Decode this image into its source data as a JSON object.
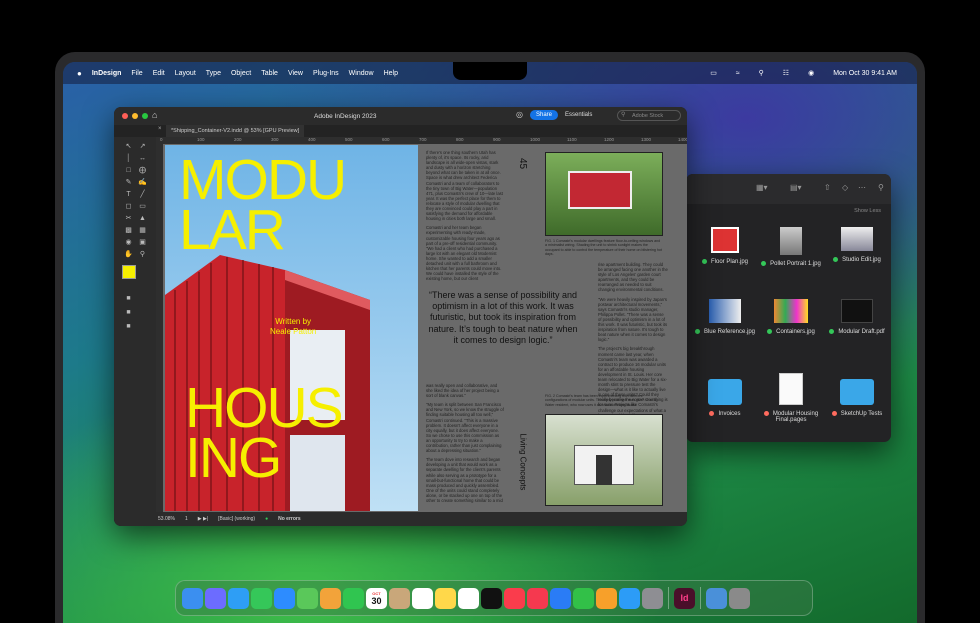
{
  "menubar": {
    "apple": "",
    "items": [
      "InDesign",
      "File",
      "Edit",
      "Layout",
      "Type",
      "Object",
      "Table",
      "View",
      "Plug-Ins",
      "Window",
      "Help"
    ],
    "datetime": "Mon Oct 30  9:41 AM"
  },
  "indesign": {
    "window_title": "Adobe InDesign 2023",
    "share_label": "Share",
    "workspace": "Essentials",
    "stock_placeholder": "Adobe Stock",
    "doc_tab": "*Shipping_Container-V2.indd @ 53% [GPU Preview]",
    "ruler_ticks": [
      "0",
      "100",
      "200",
      "300",
      "400",
      "500",
      "600",
      "700",
      "800",
      "900",
      "1000",
      "1100",
      "1200",
      "1300",
      "1400"
    ],
    "status": {
      "zoom": "53.08%",
      "page": "1",
      "style": "[Basic] (working)",
      "errors": "No errors"
    },
    "spread": {
      "title_top": "MODU\nLAR",
      "title_bottom": "HOUS\nING",
      "byline": "Written by\nNeale Patton",
      "page_number": "45",
      "side_title": "Living Concepts",
      "quote": "“There was a sense of possibility and optimism in a lot of this work. It was futuristic, but took its inspiration from nature. It’s tough to beat nature when it comes to design logic.”",
      "col1_top": "If there's one thing southern Utah has plenty of, it's space. Its rocky, arid landscape is all wide-open vistas, stark and dusty with a horizon stretching beyond what can be taken in at all once. Space is what drew architect Federica Comastri and a team of collaborators to the tiny town of Big Water—population 471, plus Comastri's crew of 10—late last year. It was the perfect place for them to relocate a style of modular dwelling that they are convinced could play a part in satisfying the demand for affordable housing in cities both large and small.",
      "col1_top2": "Comastri and her team began experimenting with ready-made, customizable housing four years ago as part of a pre-off residential community. \"We had a client who had purchased a large lot with an elegant old Modernist home. She wanted to add a smaller detached unit with a full bathroom and kitchen that her parents could move into. We could have installed the style of the existing home, but our client",
      "col1_bottom": "was really open and collaborative, and she liked the idea of her project being a sort of blank canvas.\"",
      "col1_bottom2": "\"My team is split between San Francisco and New York, so we know the struggle of finding suitable housing all too well,\" Comastri continued. \"This is a massive problem. It doesn't affect everyone in a city equally, but it does affect everyone. So we chose to use this commission as an opportunity to try to make a contribution, rather than just complaining about a depressing situation.\"",
      "col1_bottom3": "The team dove into research and began developing a unit that would work as a separate dwelling for the client's parents while also serving as a prototype for a small-but-functional home that could be mass produced and quickly assembled. One of the units could stand completely alone, or be stacked up one on top of the other to create something similar to a mid",
      "col2": "rise apartment building. They could be arranged facing one another in the style of Los Angeles' garden court apartments, and they could be rearranged as needed to suit changing environmental conditions.",
      "col2b": "\"We were heavily inspired by Japan's postwar architectural movements,\" says Comastri's studio manager, Philippa Pollet. \"There was a sense of possibility and optimism in a lot of this work. It was futuristic, but took its inspiration from nature. It's tough to beat nature when it comes to design logic.\"",
      "col2c": "The project's big breakthrough moment came last year, when Comastri's team was awarded a contract to produce 16 modular units for an affordable housing development in St. Louis. Her core team relocated to Big Water for a six-month stint to pressure test the design—what is it like to actually live in one of these units? Could they really become the norm? One thing is for sure: Projects like Comastri's challenge our expectations of what a home should look like.",
      "cap1": "FIG. 1      Comastri's modular dwellings feature floor-to-ceiling windows and a minimalist wiring. Shading the unit to shrink sunlight makes the occupant to able to control the temperature of their home on blistering hot days.",
      "cap2": "FIG. 2      Comastri's team has been experimenting with different configurations of modular units. This early prototype was given to a Big Water resident, who now uses it as a woodworking studio."
    }
  },
  "finder": {
    "show_less": "Show Less",
    "items": [
      {
        "name": "Floor Plan.jpg",
        "tag": "#34c759"
      },
      {
        "name": "Pollet Portrait 1.jpg",
        "tag": "#34c759"
      },
      {
        "name": "Studio Edit.jpg",
        "tag": "#34c759"
      },
      {
        "name": "Blue Reference.jpg",
        "tag": "#34c759"
      },
      {
        "name": "Containers.jpg",
        "tag": "#34c759"
      },
      {
        "name": "Modular Draft.pdf",
        "tag": "#34c759"
      },
      {
        "name": "Invoices",
        "tag": "#ff6b5e"
      },
      {
        "name": "Modular Housing Final.pages",
        "tag": "#ff6b5e"
      },
      {
        "name": "SketchUp Tests",
        "tag": "#ff6b5e"
      }
    ]
  },
  "dock": {
    "calendar_month": "OCT",
    "calendar_day": "30",
    "id_label": "Id",
    "apps": [
      "finder",
      "launchpad",
      "safari",
      "messages",
      "mail",
      "maps",
      "photos",
      "facetime",
      "calendar",
      "contacts",
      "reminders",
      "notes",
      "freeform",
      "tv",
      "music",
      "news",
      "keynote",
      "numbers",
      "pages",
      "app-store",
      "system-settings",
      "indesign",
      "downloads",
      "trash"
    ]
  }
}
